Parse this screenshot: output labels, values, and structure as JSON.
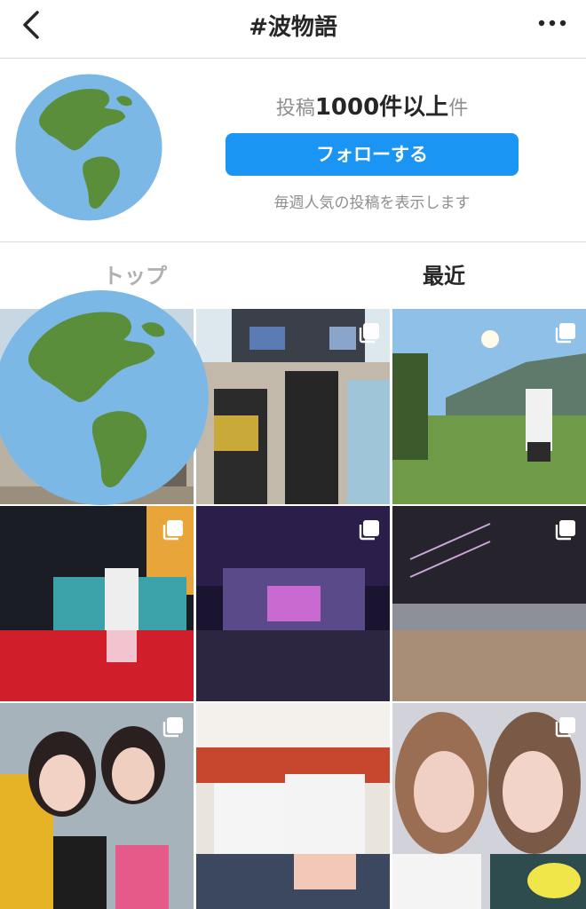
{
  "header": {
    "title": "#波物語",
    "back_icon": "chevron-left-icon",
    "more_icon": "more-horizontal-icon"
  },
  "profile": {
    "avatar_icon": "globe-americas-icon",
    "post_count_prefix": "投稿",
    "post_count": "1000件以上",
    "post_count_suffix": "件",
    "follow_label": "フォローする",
    "note": "毎週人気の投稿を表示します"
  },
  "tabs": {
    "top": "トップ",
    "recent": "最近"
  },
  "colors": {
    "accent": "#1a95f3",
    "muted": "#8e8e8e",
    "divider": "#dbdbdb",
    "globe_ocean": "#7cb8e6",
    "globe_land": "#5a8e3a"
  },
  "grid": {
    "multi_icon": "multiple-images-icon",
    "posts": [
      {
        "subject": "festival crowd",
        "multi": false
      },
      {
        "subject": "concert stage crowd",
        "multi": true
      },
      {
        "subject": "hillside person",
        "multi": true
      },
      {
        "subject": "dancer on red stage",
        "multi": true
      },
      {
        "subject": "night stage lights",
        "multi": true
      },
      {
        "subject": "stage crowd daytime",
        "multi": true
      },
      {
        "subject": "two women selfie",
        "multi": true
      },
      {
        "subject": "two men seated",
        "multi": false
      },
      {
        "subject": "two women selfie shaved ice",
        "multi": true
      }
    ]
  }
}
